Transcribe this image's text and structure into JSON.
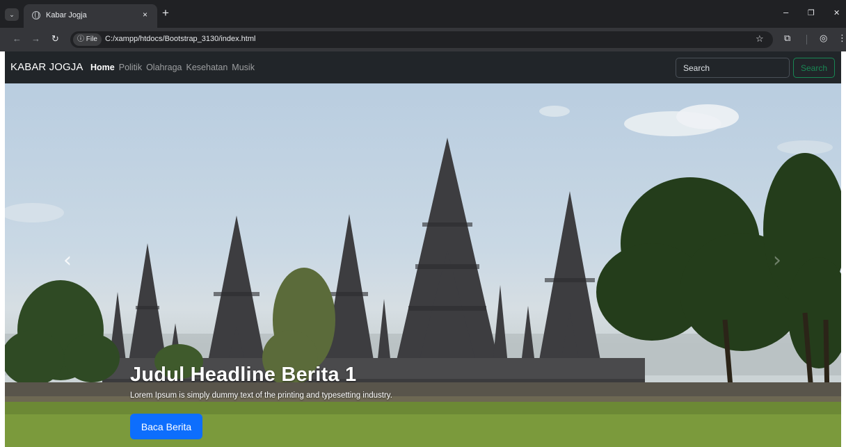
{
  "browser": {
    "tab_title": "Kabar Jogja",
    "tab_close": "×",
    "new_tab": "+",
    "chip_label": "ⓘ File",
    "url": "C:/xampp/htdocs/Bootstrap_3130/index.html",
    "icons": {
      "back": "←",
      "forward": "→",
      "reload": "↻",
      "bookmark": "☆",
      "extensions": "⧉",
      "profile": "◎",
      "menu": "⋮",
      "minimize": "–",
      "restore": "❐",
      "close": "✕",
      "tab_search": "⌄"
    }
  },
  "navbar": {
    "brand": "KABAR JOGJA",
    "links": [
      "Home",
      "Politik",
      "Olahraga",
      "Kesehatan",
      "Musik"
    ],
    "active_index": 0,
    "search_placeholder": "Search",
    "search_button": "Search"
  },
  "carousel": {
    "prev": "‹",
    "next": "›",
    "caption_title": "Judul Headline Berita 1",
    "caption_text": "Lorem Ipsum is simply dummy text of the printing and typesetting industry.",
    "button_label": "Baca Berita"
  },
  "colors": {
    "navbar_bg": "#212529",
    "primary": "#0d6efd",
    "success": "#198754",
    "chrome_bg": "#202124"
  }
}
